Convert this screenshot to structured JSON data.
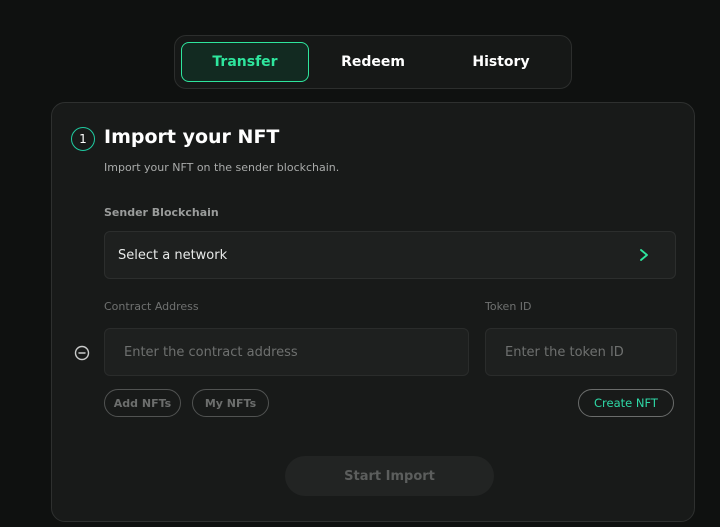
{
  "tabs": [
    {
      "label": "Transfer",
      "active": true
    },
    {
      "label": "Redeem",
      "active": false
    },
    {
      "label": "History",
      "active": false
    }
  ],
  "card": {
    "step_number": "1",
    "title": "Import your NFT",
    "subtitle": "Import your NFT on the sender blockchain.",
    "sender_blockchain": {
      "label": "Sender Blockchain",
      "value": "Select a network",
      "icon": "chevron-right-icon"
    },
    "contract_address": {
      "label": "Contract Address",
      "placeholder": "Enter the contract address",
      "value": ""
    },
    "token_id": {
      "label": "Token ID",
      "placeholder": "Enter the token ID",
      "value": ""
    },
    "remove_icon": "minus-circle-icon",
    "buttons": {
      "add_nfts": "Add NFTs",
      "my_nfts": "My NFTs",
      "create_nft": "Create NFT",
      "start_import": "Start Import"
    }
  },
  "colors": {
    "accent": "#2ee59d",
    "background": "#0f1110",
    "card": "#181a19"
  }
}
